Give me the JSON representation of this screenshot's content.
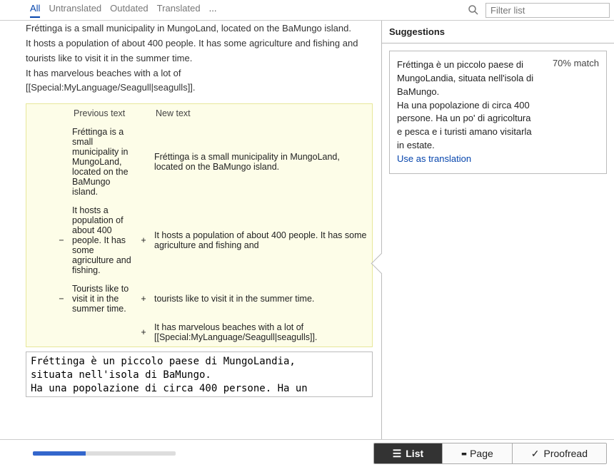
{
  "topbar": {
    "tabs": {
      "all": "All",
      "untranslated": "Untranslated",
      "outdated": "Outdated",
      "translated": "Translated",
      "ellipsis": "..."
    },
    "filter_placeholder": "Filter list"
  },
  "source": {
    "line1": "Fréttinga is a small municipality in MungoLand, located on the BaMungo island.",
    "line2": "It hosts a population of about 400 people. It has some agriculture and fishing and",
    "line3": "tourists like to visit it in the summer time.",
    "line4": "It has marvelous beaches with a lot of",
    "line5": "[[Special:MyLanguage/Seagull|seagulls]]."
  },
  "diff": {
    "headers": {
      "previous": "Previous text",
      "new": "New text"
    },
    "rows": [
      {
        "sign_prev": "",
        "prev": "Fréttinga is a small municipality in MungoLand, located on the BaMungo island.",
        "sign_new": "",
        "new": "Fréttinga is a small municipality in MungoLand, located on the BaMungo island."
      },
      {
        "sign_prev": "−",
        "prev": "It hosts a population of about 400 people. It has some agriculture and fishing.",
        "sign_new": "+",
        "new": "It hosts a population of about 400 people. It has some agriculture and fishing and"
      },
      {
        "sign_prev": "−",
        "prev": "Tourists like to visit it in the summer time.",
        "sign_new": "+",
        "new": "tourists like to visit it in the summer time."
      },
      {
        "sign_prev": "",
        "prev": "",
        "sign_new": "+",
        "new": "It has marvelous beaches with a lot of [[Special:MyLanguage/Seagull|seagulls]]."
      }
    ]
  },
  "translate": {
    "value": "Fréttinga è un piccolo paese di MungoLandia,\nsituata nell'isola di BaMungo.\nHa una popolazione di circa 400 persone. Ha un"
  },
  "suggestions": {
    "title": "Suggestions",
    "match": "70% match",
    "body": "Fréttinga è un piccolo paese di MungoLandia, situata nell'isola di BaMungo.\nHa una popolazione di circa 400 persone. Ha un po' di agricoltura e pesca e i turisti amano visitarla in estate.",
    "use_link": "Use as translation"
  },
  "bottombar": {
    "buttons": {
      "list": "List",
      "page": "Page",
      "proofread": "Proofread"
    },
    "progress_percent": 37
  }
}
